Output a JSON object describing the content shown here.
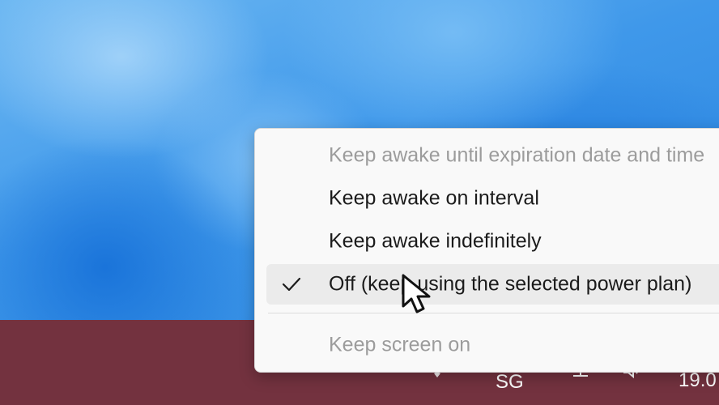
{
  "menu": {
    "items": [
      {
        "label": "Keep awake until expiration date and time",
        "enabled": false,
        "checked": false
      },
      {
        "label": "Keep awake on interval",
        "enabled": true,
        "checked": false
      },
      {
        "label": "Keep awake indefinitely",
        "enabled": true,
        "checked": false
      },
      {
        "label": "Off (keep using the selected power plan)",
        "enabled": true,
        "checked": true
      },
      {
        "label": "Keep screen on",
        "enabled": false,
        "checked": false
      }
    ]
  },
  "taskbar": {
    "language": "SG",
    "clock": "19.0",
    "icons": [
      "wifi-icon",
      "network-icon",
      "volume-icon"
    ]
  },
  "colors": {
    "taskbar": "#73323f",
    "menu_background": "#f9f9f9",
    "selected_item": "#ebebeb",
    "disabled_text": "#9c9c9c"
  }
}
